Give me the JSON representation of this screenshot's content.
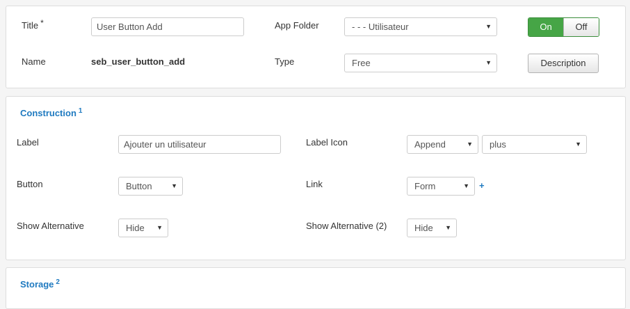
{
  "top": {
    "title_label": "Title",
    "required_mark": "*",
    "title_value": "User Button Add",
    "app_folder_label": "App Folder",
    "app_folder_value": "- - - Utilisateur",
    "toggle_on": "On",
    "toggle_off": "Off",
    "name_label": "Name",
    "name_value": "seb_user_button_add",
    "type_label": "Type",
    "type_value": "Free",
    "description_button": "Description"
  },
  "construction": {
    "title": "Construction",
    "footnote": "1",
    "label_label": "Label",
    "label_value": "Ajouter un utilisateur",
    "label_icon_label": "Label Icon",
    "label_icon_position": "Append",
    "label_icon_value": "plus",
    "button_label": "Button",
    "button_value": "Button",
    "link_label": "Link",
    "link_value": "Form",
    "link_add": "+",
    "show_alt_label": "Show Alternative",
    "show_alt_value": "Hide",
    "show_alt2_label": "Show Alternative (2)",
    "show_alt2_value": "Hide"
  },
  "storage": {
    "title": "Storage",
    "footnote": "2"
  },
  "icons": {
    "caret": "caret-down-icon",
    "plus": "plus-icon"
  },
  "colors": {
    "accent_blue": "#1f7ac0",
    "toggle_green": "#46a546"
  }
}
